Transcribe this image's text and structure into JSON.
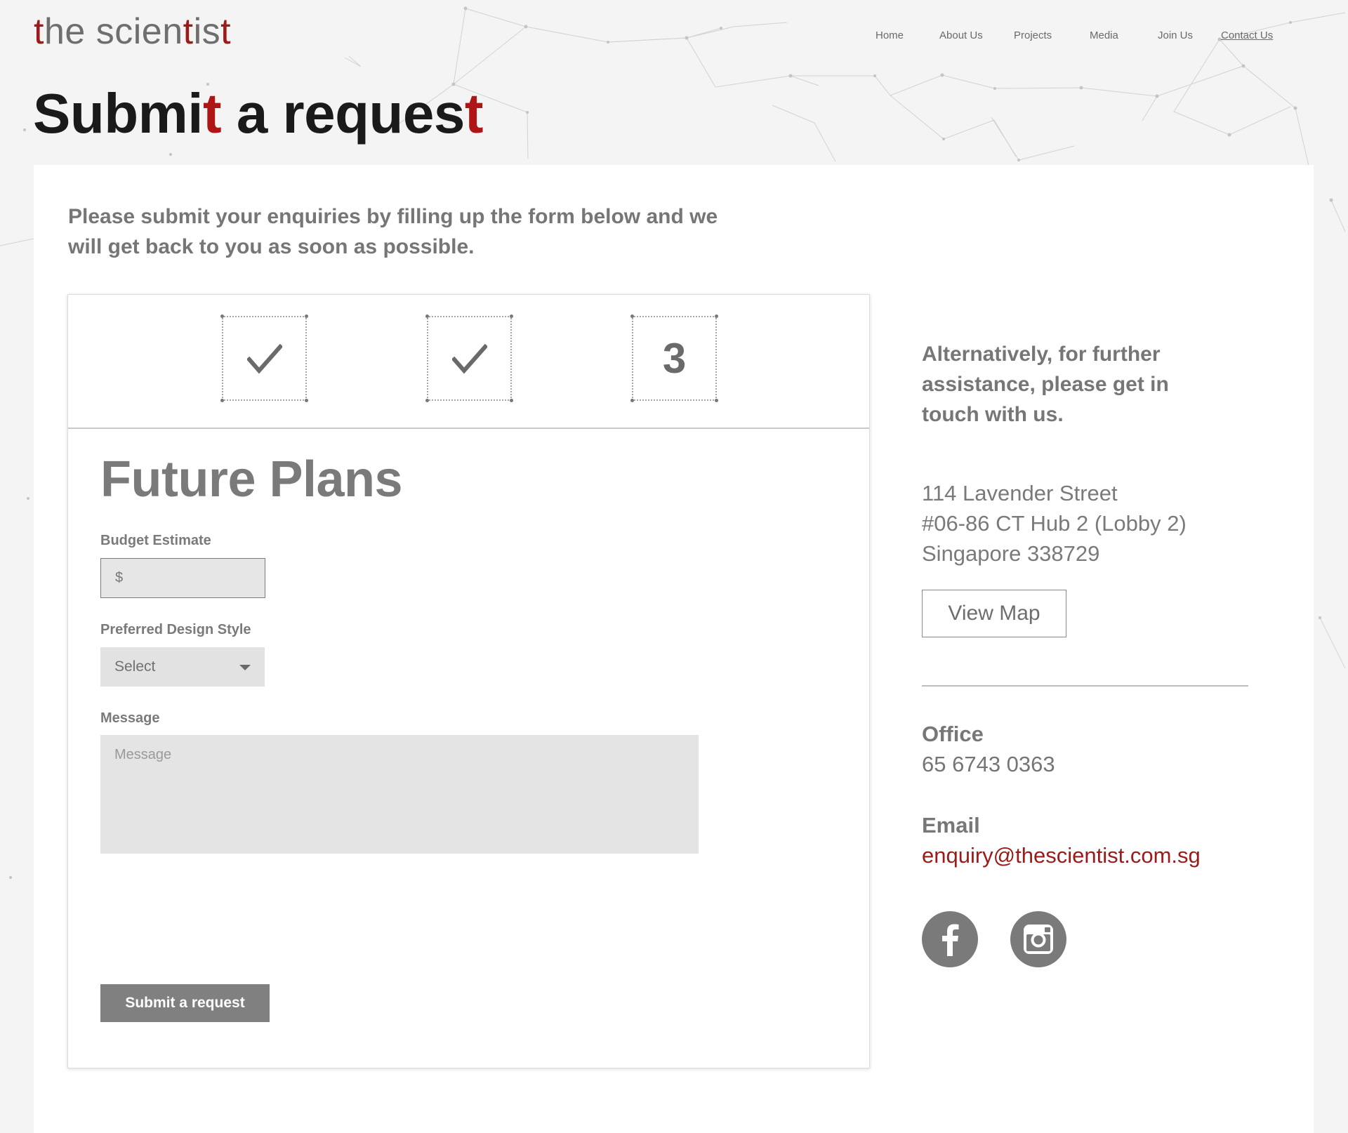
{
  "logo": {
    "part1": "the scien",
    "t1": "t",
    "part2": "is",
    "t2": "t"
  },
  "nav": {
    "items": [
      {
        "label": "Home",
        "active": false
      },
      {
        "label": "About Us",
        "active": false
      },
      {
        "label": "Projects",
        "active": false
      },
      {
        "label": "Media",
        "active": false
      },
      {
        "label": "Join Us",
        "active": false
      },
      {
        "label": "Contact Us",
        "active": true
      }
    ]
  },
  "page_title": {
    "part1": "Submi",
    "t1": "t",
    "part2": " a reques",
    "t2": "t"
  },
  "intro": "Please submit your enquiries by filling up the form below and we will get back to you as soon as possible.",
  "steps": [
    {
      "state": "complete",
      "icon": "checkmark-icon"
    },
    {
      "state": "complete",
      "icon": "checkmark-icon"
    },
    {
      "state": "current",
      "number": "3"
    }
  ],
  "form": {
    "title": "Future Plans",
    "budget": {
      "label": "Budget Estimate",
      "prefix": "$",
      "value": ""
    },
    "design_style": {
      "label": "Preferred Design Style",
      "selected": "Select"
    },
    "message": {
      "label": "Message",
      "placeholder": "Message",
      "value": ""
    },
    "submit_label": "Submit a request"
  },
  "contact": {
    "intro": "Alternatively, for further assistance, please get in touch with us.",
    "address": [
      "114 Lavender Street",
      "#06-86 CT Hub 2 (Lobby 2)",
      "Singapore 338729"
    ],
    "view_map_label": "View Map",
    "office": {
      "label": "Office",
      "value": "65 6743 0363"
    },
    "email": {
      "label": "Email",
      "value": "enquiry@thescientist.com.sg"
    },
    "social": [
      {
        "name": "facebook",
        "icon": "facebook-icon"
      },
      {
        "name": "instagram",
        "icon": "instagram-icon"
      }
    ]
  },
  "colors": {
    "accent": "#9b1b1b",
    "text_grey": "#7a7a7a",
    "background": "#f4f4f4",
    "button": "#808080"
  }
}
